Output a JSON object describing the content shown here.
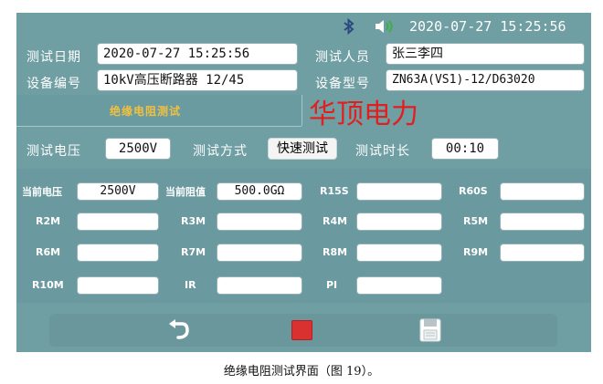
{
  "status": {
    "datetime": "2020-07-27  15:25:56",
    "icons": [
      "bluetooth-icon",
      "speaker-icon"
    ]
  },
  "header": {
    "test_date_label": "测试日期",
    "test_date_value": "2020-07-27  15:25:56",
    "tester_label": "测试人员",
    "tester_value": "张三李四",
    "device_no_label": "设备编号",
    "device_no_value": "10kV高压断路器 12/45",
    "device_model_label": "设备型号",
    "device_model_value": "ZN63A(VS1)-12/D63020"
  },
  "tab": {
    "label": "绝缘电阻测试"
  },
  "watermark": "华顶电力",
  "settings": {
    "voltage_label": "测试电压",
    "voltage_value": "2500V",
    "mode_label": "测试方式",
    "mode_value": "快速测试",
    "duration_label": "测试时长",
    "duration_value": "00:10"
  },
  "readings": {
    "current_voltage_label": "当前电压",
    "current_voltage_value": "2500V",
    "current_resistance_label": "当前阻值",
    "current_resistance_value": "500.0GΩ",
    "r15s_label": "R15S",
    "r60s_label": "R60S",
    "r2m_label": "R2M",
    "r3m_label": "R3M",
    "r4m_label": "R4M",
    "r5m_label": "R5M",
    "r6m_label": "R6M",
    "r7m_label": "R7M",
    "r8m_label": "R8M",
    "r9m_label": "R9M",
    "r10m_label": "R10M",
    "ir_label": "IR",
    "pi_label": "PI"
  },
  "toolbar": {
    "back_icon": "back-arrow-icon",
    "stop_icon": "stop-icon",
    "save_icon": "save-icon"
  },
  "colors": {
    "screen_bg": "#6f9ea3",
    "tab_text": "#f0c040",
    "watermark": "#e02020",
    "stop_red": "#d93030"
  },
  "caption": "绝缘电阻测试界面（图 19）。"
}
